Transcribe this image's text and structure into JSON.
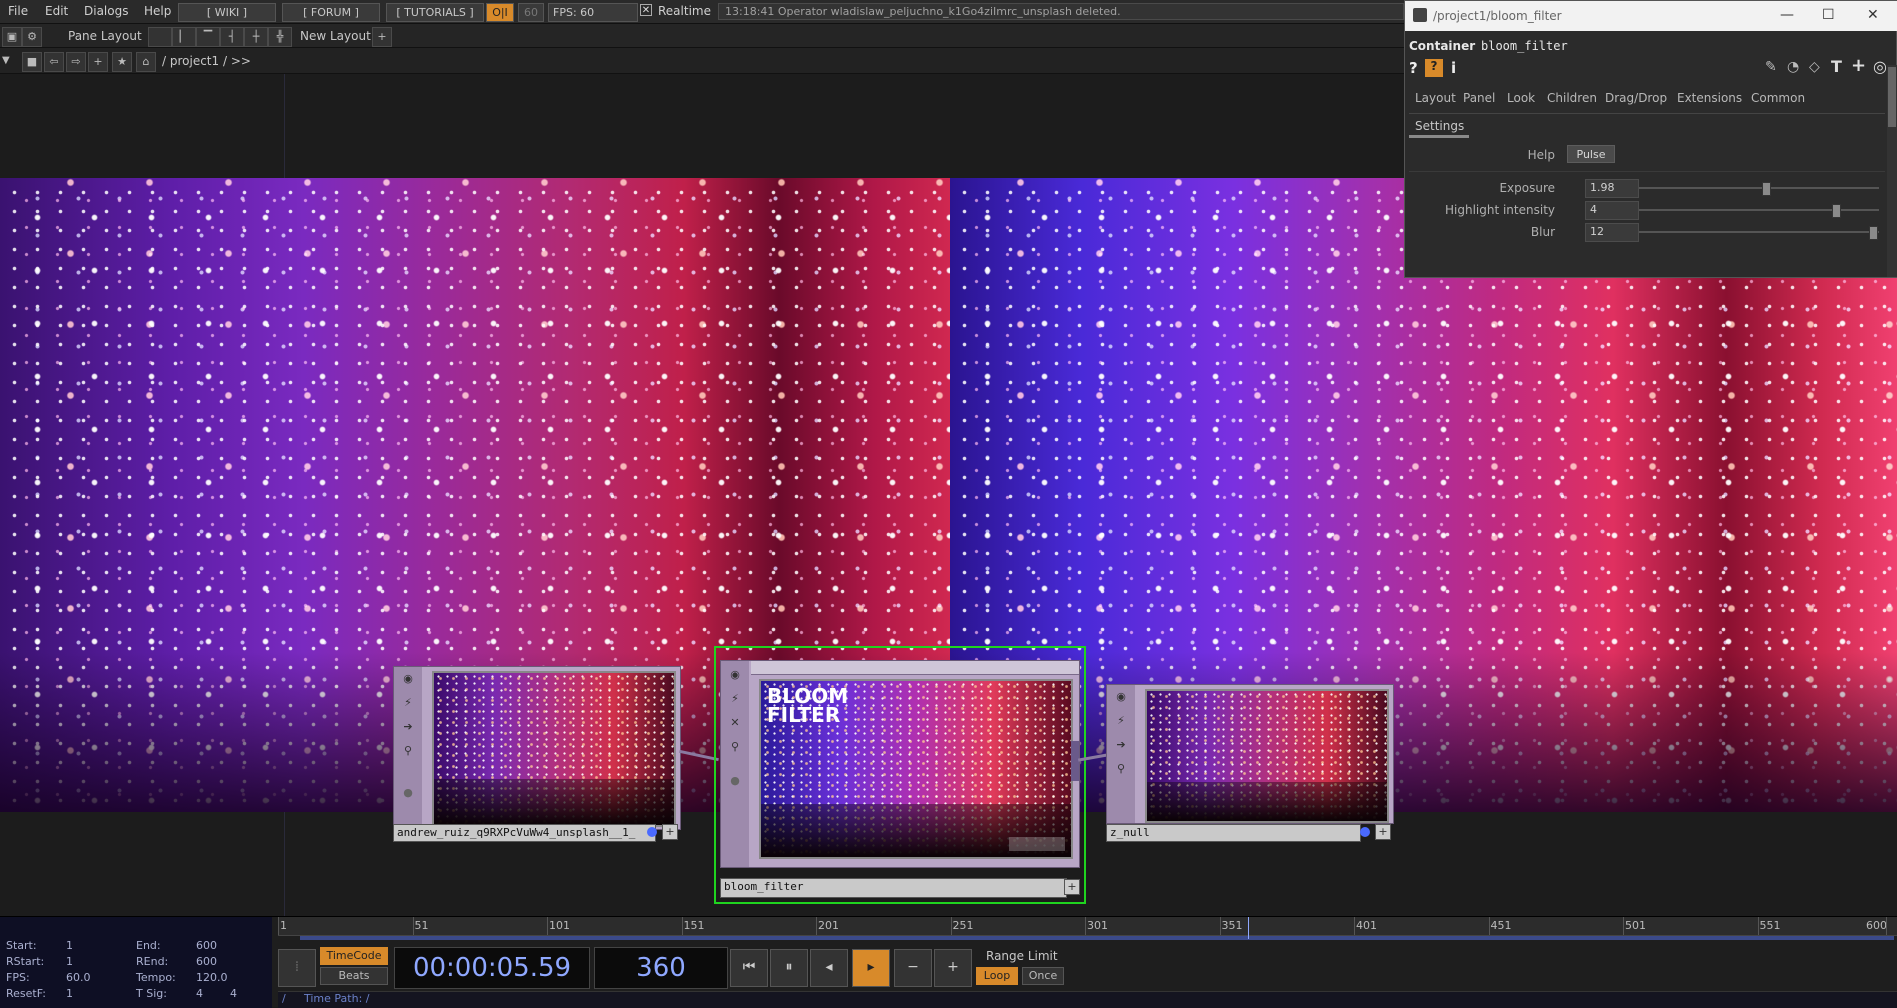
{
  "menubar": {
    "items": [
      "File",
      "Edit",
      "Dialogs",
      "Help"
    ],
    "buttons": [
      "[ WIKI ]",
      "[ FORUM ]",
      "[ TUTORIALS ]"
    ],
    "oi": "O|I",
    "fps_target": "60",
    "fps_label": "FPS:",
    "fps_value": "60",
    "realtime_label": "Realtime",
    "status_message": "13:18:41 Operator wladislaw_peljuchno_k1Go4ziImrc_unsplash deleted."
  },
  "toolbar": {
    "pane_layout": "Pane Layout",
    "new_layout": "New Layout",
    "path": "/ project1 / >>"
  },
  "param_window": {
    "title": "/project1/bloom_filter",
    "type_label": "Container",
    "op_name": "bloom_filter",
    "tabs": [
      "Layout",
      "Panel",
      "Look",
      "Children",
      "Drag/Drop",
      "Extensions",
      "Common"
    ],
    "active_subtab": "Settings",
    "help_label": "Help",
    "pulse_label": "Pulse",
    "params": [
      {
        "label": "Exposure",
        "value": "1.98",
        "fraction": 0.53
      },
      {
        "label": "Highlight intensity",
        "value": "4",
        "fraction": 0.83
      },
      {
        "label": "Blur",
        "value": "12",
        "fraction": 0.99
      }
    ]
  },
  "nodes": {
    "source_label": "andrew_ruiz_q9RXPcVuWw4_unsplash__1_",
    "bloom_label": "bloom_filter",
    "bloom_overlay_line1": "BLOOM",
    "bloom_overlay_line2": "FILTER",
    "null_label": "z_null"
  },
  "timeline": {
    "info": {
      "start_label": "Start:",
      "start": "1",
      "end_label": "End:",
      "end": "600",
      "rstart_label": "RStart:",
      "rstart": "1",
      "rend_label": "REnd:",
      "rend": "600",
      "fps_label": "FPS:",
      "fps": "60.0",
      "tempo_label": "Tempo:",
      "tempo": "120.0",
      "resetf_label": "ResetF:",
      "resetf": "1",
      "tsig_label": "T Sig:",
      "tsig_a": "4",
      "tsig_b": "4"
    },
    "ruler_ticks": [
      "1",
      "51",
      "101",
      "151",
      "201",
      "251",
      "301",
      "351",
      "401",
      "451",
      "501",
      "551",
      "600"
    ],
    "timecode_label": "TimeCode",
    "beats_label": "Beats",
    "timecode": "00:00:05.59",
    "frame": "360",
    "range_limit": "Range Limit",
    "loop_label": "Loop",
    "once_label": "Once",
    "time_path": "Time Path: /"
  },
  "colors": {
    "accent_orange": "#d88a2a",
    "selection_green": "#1fd41f",
    "timecode_blue": "#8fa8ff"
  }
}
